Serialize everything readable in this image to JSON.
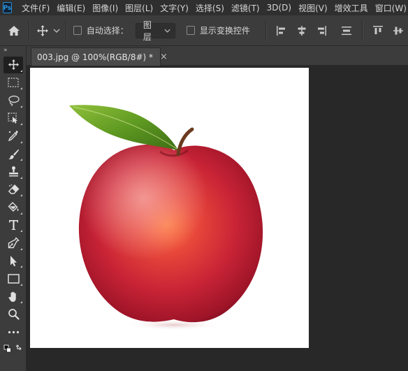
{
  "app": {
    "logo_text": "Ps"
  },
  "menu": [
    "文件(F)",
    "编辑(E)",
    "图像(I)",
    "图层(L)",
    "文字(Y)",
    "选择(S)",
    "滤镜(T)",
    "3D(D)",
    "视图(V)",
    "增效工具",
    "窗口(W)"
  ],
  "options": {
    "auto_select_label": "自动选择：",
    "auto_select_target": "图层",
    "show_transform_label": "显示变换控件"
  },
  "toolbox": {
    "collapse_glyph": "»"
  },
  "document": {
    "tab_title": "003.jpg @ 100%(RGB/8#) *",
    "close_glyph": "×"
  },
  "colors": {
    "menubar": "#2f2f2f",
    "panel": "#3c3c3c",
    "workspace": "#282828",
    "canvas": "#ffffff",
    "accent_ps": "#31a8ff"
  }
}
